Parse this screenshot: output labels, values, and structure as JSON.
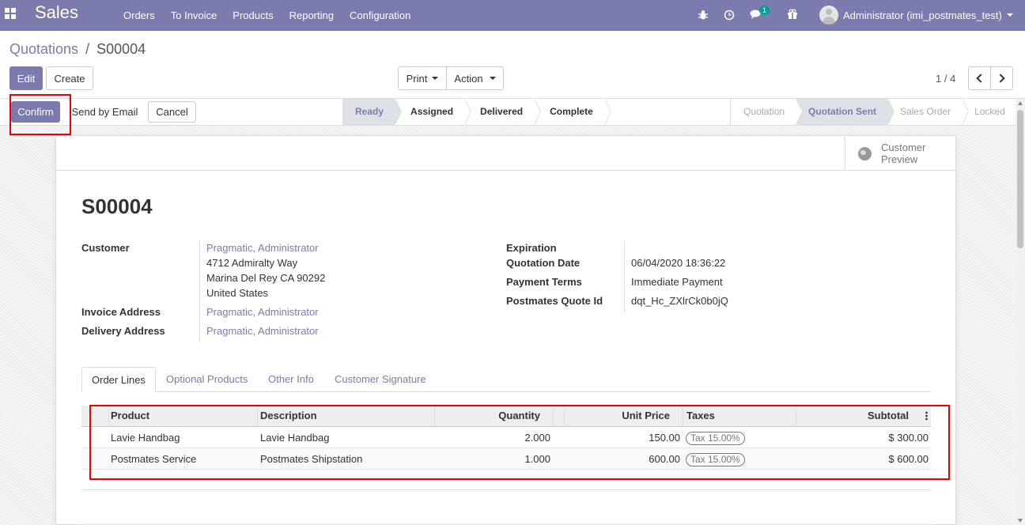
{
  "navbar": {
    "app_name": "Sales",
    "menu": [
      "Orders",
      "To Invoice",
      "Products",
      "Reporting",
      "Configuration"
    ],
    "message_count": "1",
    "user": "Administrator (imi_postmates_test)"
  },
  "breadcrumb": {
    "parent": "Quotations",
    "separator": "/",
    "current": "S00004"
  },
  "control": {
    "edit_label": "Edit",
    "create_label": "Create",
    "print_label": "Print",
    "action_label": "Action",
    "pager": "1 / 4"
  },
  "statusbar": {
    "buttons": {
      "confirm": "Confirm",
      "send_email": "Send by Email",
      "cancel": "Cancel"
    },
    "picking_steps": [
      "Ready",
      "Assigned",
      "Delivered",
      "Complete"
    ],
    "picking_active": "Ready",
    "states": [
      "Quotation",
      "Quotation Sent",
      "Sales Order",
      "Locked"
    ],
    "state_active": "Quotation Sent"
  },
  "smart_button": {
    "line1": "Customer",
    "line2": "Preview",
    "icon": "globe-icon"
  },
  "record": {
    "name": "S00004",
    "customer_label": "Customer",
    "customer_name": "Pragmatic, Administrator",
    "customer_address": [
      "4712 Admiralty Way",
      "Marina Del Rey CA 90292",
      "United States"
    ],
    "invoice_label": "Invoice Address",
    "invoice_value": "Pragmatic, Administrator",
    "delivery_label": "Delivery Address",
    "delivery_value": "Pragmatic, Administrator",
    "expiration_label": "Expiration",
    "expiration_value": "",
    "quote_date_label": "Quotation Date",
    "quote_date_value": "06/04/2020 18:36:22",
    "payment_label": "Payment Terms",
    "payment_value": "Immediate Payment",
    "postmates_label": "Postmates Quote Id",
    "postmates_value": "dqt_Hc_ZXlrCk0b0jQ"
  },
  "tabs": [
    "Order Lines",
    "Optional Products",
    "Other Info",
    "Customer Signature"
  ],
  "tab_active": "Order Lines",
  "order_lines": {
    "columns": [
      "Product",
      "Description",
      "Quantity",
      "Unit Price",
      "Taxes",
      "Subtotal"
    ],
    "rows": [
      {
        "product": "Lavie Handbag",
        "description": "Lavie Handbag",
        "quantity": "2.000",
        "unit_price": "150.00",
        "tax": "Tax 15.00%",
        "subtotal": "$ 300.00"
      },
      {
        "product": "Postmates Service",
        "description": "Postmates Shipstation",
        "quantity": "1.000",
        "unit_price": "600.00",
        "tax": "Tax 15.00%",
        "subtotal": "$ 600.00"
      }
    ]
  },
  "colors": {
    "brand": "#7c7bad",
    "highlight": "#e00000"
  }
}
